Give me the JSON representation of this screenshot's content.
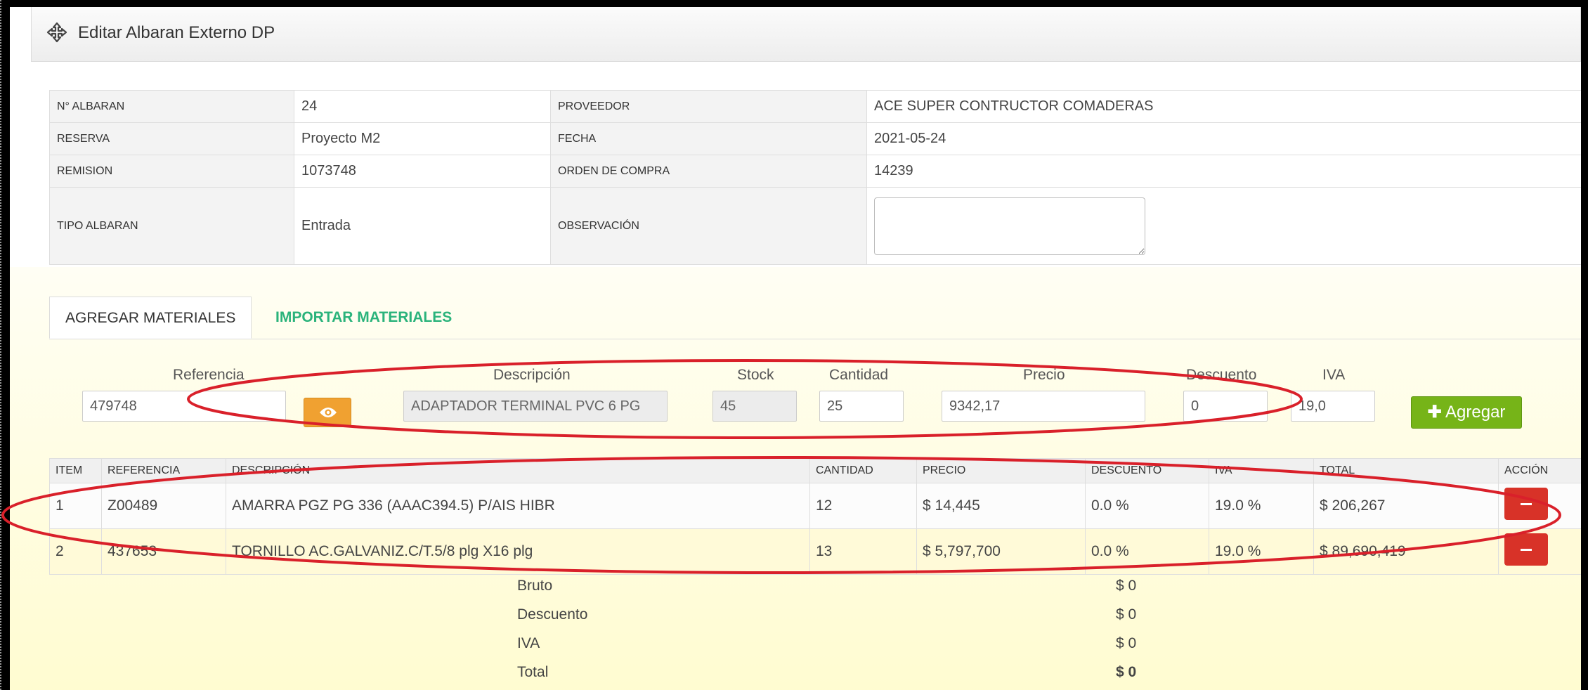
{
  "header": {
    "title": "Editar Albaran Externo DP"
  },
  "info": {
    "rows": [
      {
        "l1": "N° ALBARAN",
        "v1": "24",
        "l2": "PROVEEDOR",
        "v2": "ACE SUPER CONTRUCTOR COMADERAS"
      },
      {
        "l1": "RESERVA",
        "v1": "Proyecto M2",
        "l2": "FECHA",
        "v2": "2021-05-24"
      },
      {
        "l1": "REMISION",
        "v1": "1073748",
        "l2": "ORDEN DE COMPRA",
        "v2": "14239"
      },
      {
        "l1": "TIPO ALBARAN",
        "v1": "Entrada",
        "l2": "OBSERVACIÓN",
        "v2": ""
      }
    ]
  },
  "tabs": [
    {
      "label": "AGREGAR MATERIALES"
    },
    {
      "label": "IMPORTAR MATERIALES"
    }
  ],
  "form": {
    "labels": {
      "referencia": "Referencia",
      "descripcion": "Descripción",
      "stock": "Stock",
      "cantidad": "Cantidad",
      "precio": "Precio",
      "descuento": "Descuento",
      "iva": "IVA"
    },
    "values": {
      "referencia": "479748",
      "descripcion": "ADAPTADOR TERMINAL PVC 6 PG",
      "stock": "45",
      "cantidad": "25",
      "precio": "9342,17",
      "descuento": "0",
      "iva": "19,0"
    },
    "add_label": "Agregar"
  },
  "items": {
    "headers": [
      "ITEM",
      "REFERENCIA",
      "DESCRIPCIÓN",
      "CANTIDAD",
      "PRECIO",
      "DESCUENTO",
      "IVA",
      "TOTAL",
      "ACCIÓN"
    ],
    "rows": [
      [
        "1",
        "Z00489",
        "AMARRA PGZ PG 336 (AAAC394.5) P/AIS HIBR",
        "12",
        "$ 14,445",
        "0.0 %",
        "19.0 %",
        "$ 206,267"
      ],
      [
        "2",
        "437653",
        "TORNILLO AC.GALVANIZ.C/T.5/8 plg X16 plg",
        "13",
        "$ 5,797,700",
        "0.0 %",
        "19.0 %",
        "$ 89,690,419"
      ]
    ]
  },
  "totals": [
    {
      "label": "Bruto",
      "value": "$ 0"
    },
    {
      "label": "Descuento",
      "value": "$ 0"
    },
    {
      "label": "IVA",
      "value": "$ 0"
    },
    {
      "label": "Total",
      "value": "$ 0"
    }
  ],
  "colors": {
    "annotation": "#d9202a",
    "add_button": "#76b418",
    "view_button": "#f0a131",
    "remove_button": "#d83228",
    "tab_inactive": "#2ab37b"
  }
}
